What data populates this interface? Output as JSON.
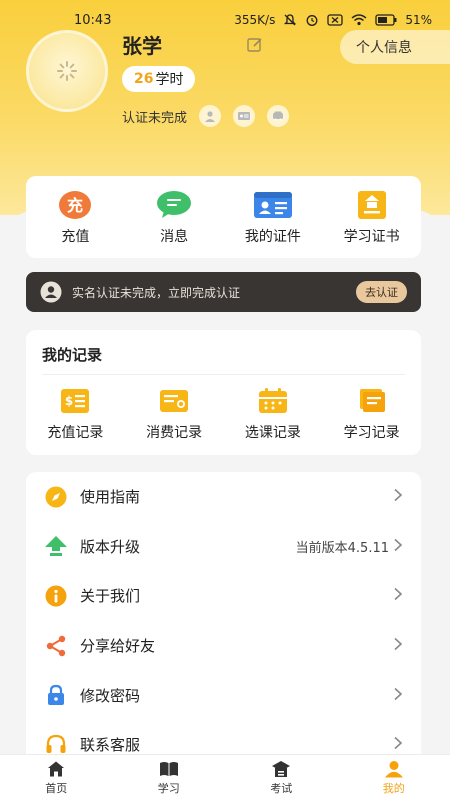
{
  "status_bar": {
    "time": "10:43",
    "network_speed": "355K/s",
    "battery": "51%"
  },
  "profile": {
    "name": "张学",
    "hours_value": "26",
    "hours_unit": "学时",
    "personal_info_label": "个人信息",
    "verify_status": "认证未完成"
  },
  "quick_actions": [
    {
      "label": "充值",
      "icon": "recharge-icon",
      "glyph": "充"
    },
    {
      "label": "消息",
      "icon": "message-icon"
    },
    {
      "label": "我的证件",
      "icon": "id-card-icon"
    },
    {
      "label": "学习证书",
      "icon": "certificate-icon"
    }
  ],
  "banner": {
    "text": "实名认证未完成，立即完成认证",
    "button_label": "去认证"
  },
  "records": {
    "title": "我的记录",
    "items": [
      {
        "label": "充值记录",
        "icon": "recharge-record-icon"
      },
      {
        "label": "消费记录",
        "icon": "consume-record-icon"
      },
      {
        "label": "选课记录",
        "icon": "course-record-icon"
      },
      {
        "label": "学习记录",
        "icon": "study-record-icon"
      }
    ]
  },
  "menu": [
    {
      "label": "使用指南",
      "value": "",
      "icon": "compass-icon"
    },
    {
      "label": "版本升级",
      "value": "当前版本4.5.11",
      "icon": "upgrade-arrow-icon"
    },
    {
      "label": "关于我们",
      "value": "",
      "icon": "info-icon"
    },
    {
      "label": "分享给好友",
      "value": "",
      "icon": "share-icon"
    },
    {
      "label": "修改密码",
      "value": "",
      "icon": "lock-icon"
    },
    {
      "label": "联系客服",
      "value": "",
      "icon": "headset-icon"
    }
  ],
  "tabs": [
    {
      "label": "首页",
      "icon": "home-icon",
      "active": false
    },
    {
      "label": "学习",
      "icon": "book-icon",
      "active": false
    },
    {
      "label": "考试",
      "icon": "exam-icon",
      "active": false
    },
    {
      "label": "我的",
      "icon": "profile-icon",
      "active": true
    }
  ],
  "colors": {
    "header_yellow": "#f9cf3c",
    "accent_orange": "#f2a51a",
    "banner_dark": "#383533",
    "banner_button": "#e9c89e"
  }
}
